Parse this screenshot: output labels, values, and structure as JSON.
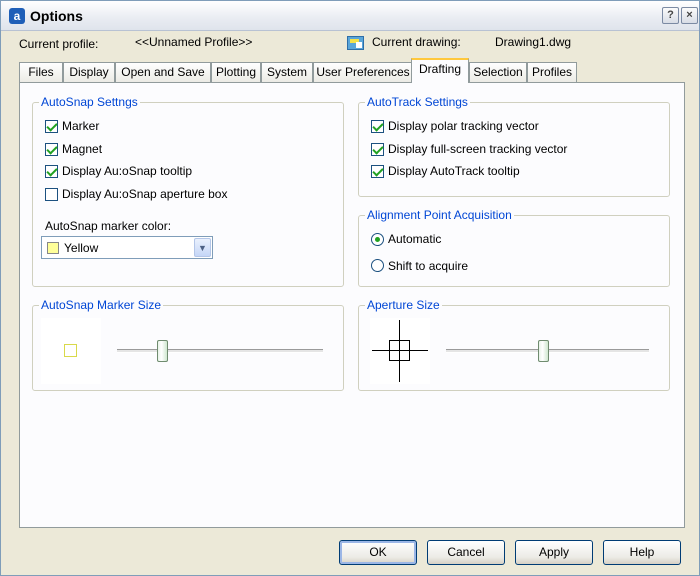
{
  "window": {
    "title": "Options",
    "app_icon_letter": "a",
    "help_glyph": "?",
    "close_glyph": "×"
  },
  "header": {
    "current_profile_label": "Current profile:",
    "current_profile_value": "<<Unnamed Profile>>",
    "current_drawing_label": "Current drawing:",
    "current_drawing_value": "Drawing1.dwg"
  },
  "tabs": [
    "Files",
    "Display",
    "Open and Save",
    "Plotting",
    "System",
    "User Preferences",
    "Drafting",
    "Selection",
    "Profiles"
  ],
  "active_tab": "Drafting",
  "autosnap": {
    "title": "AutoSnap Settngs",
    "items": [
      {
        "label": "Marker",
        "checked": true
      },
      {
        "label": "Magnet",
        "checked": true
      },
      {
        "label": "Display Au:oSnap tooltip",
        "checked": true
      },
      {
        "label": "Display Au:oSnap aperture box",
        "checked": false
      }
    ],
    "color_label": "AutoSnap marker color:",
    "color_value": "Yellow",
    "color_hex": "#ffff99"
  },
  "autotrack": {
    "title": "AutoTrack Settings",
    "items": [
      {
        "label": "Display polar tracking vector",
        "checked": true
      },
      {
        "label": "Display full-screen tracking vector",
        "checked": true
      },
      {
        "label": "Display AutoTrack tooltip",
        "checked": true
      }
    ]
  },
  "alignment": {
    "title": "Alignment Point Acquisition",
    "options": [
      {
        "label": "Automatic",
        "selected": true
      },
      {
        "label": "Shift to acquire",
        "selected": false
      }
    ]
  },
  "marker_size": {
    "title": "AutoSnap Marker Size",
    "slider_fraction": 0.22
  },
  "aperture_size": {
    "title": "Aperture Size",
    "slider_fraction": 0.48
  },
  "buttons": {
    "ok": "OK",
    "cancel": "Cancel",
    "apply": "Apply",
    "help": "Help"
  },
  "colors": {
    "group_title": "#0046d5",
    "check": "#21a121",
    "active_tab_top": "#ffc83c"
  }
}
